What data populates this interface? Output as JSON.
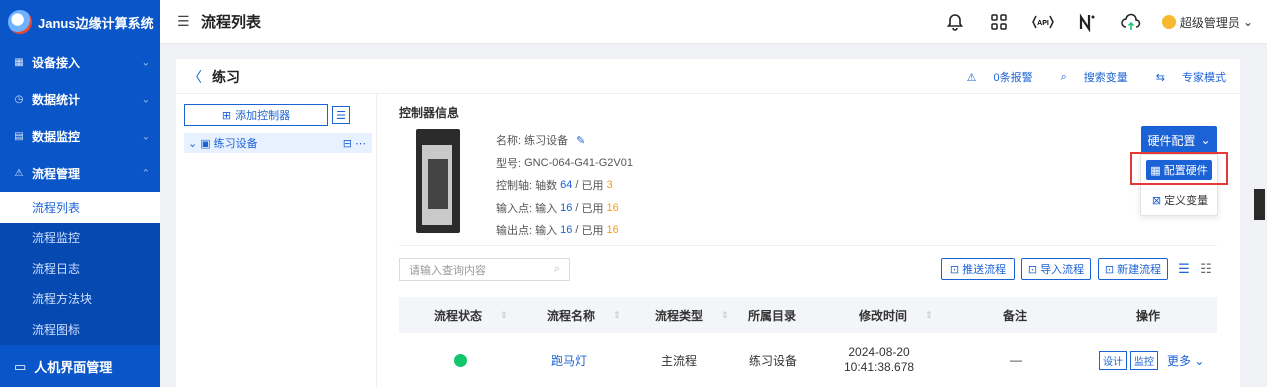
{
  "app": {
    "brand": "Janus边缘计算系统"
  },
  "sidebar": {
    "items": [
      {
        "label": "设备接入",
        "icon": "device-icon"
      },
      {
        "label": "数据统计",
        "icon": "stats-icon"
      },
      {
        "label": "数据监控",
        "icon": "monitor-icon"
      },
      {
        "label": "流程管理",
        "icon": "flow-icon"
      }
    ],
    "sub_items": [
      {
        "label": "流程列表",
        "active": true
      },
      {
        "label": "流程监控"
      },
      {
        "label": "流程日志"
      },
      {
        "label": "流程方法块"
      },
      {
        "label": "流程图标"
      }
    ],
    "bottom": {
      "label": "人机界面管理",
      "icon": "hmi-icon"
    }
  },
  "header": {
    "title": "流程列表",
    "user": "超级管理员",
    "icons": [
      "bell-icon",
      "apps-icon",
      "api-icon",
      "n-logo-icon",
      "cloud-upload-icon"
    ]
  },
  "page": {
    "breadcrumb": "练习",
    "links": {
      "alarm": "0条报警",
      "search_var": "搜索变量",
      "expert": "专家模式"
    }
  },
  "tree": {
    "add_label": "添加控制器",
    "node": "练习设备",
    "node_actions": "⋯"
  },
  "controller": {
    "section_title": "控制器信息",
    "name_label": "名称:",
    "name": "练习设备",
    "model_label": "型号:",
    "model": "GNC-064-G41-G2V01",
    "axis_label": "控制轴:",
    "axis_prefix": "轴数",
    "axis_total": "64",
    "axis_used": "3",
    "input_label": "输入点:",
    "input_prefix": "输入",
    "input_total": "16",
    "input_used": "16",
    "output_label": "输出点:",
    "output_prefix": "输入",
    "output_total": "16",
    "output_used": "16",
    "used_label": "已用",
    "slash": "/"
  },
  "hardware": {
    "button": "硬件配置",
    "menu": [
      "配置硬件",
      "定义变量"
    ]
  },
  "toolbar": {
    "search_placeholder": "请输入查询内容",
    "push": "推送流程",
    "import": "导入流程",
    "new": "新建流程"
  },
  "table": {
    "columns": [
      "流程状态",
      "流程名称",
      "流程类型",
      "所属目录",
      "修改时间",
      "备注",
      "操作"
    ],
    "rows": [
      {
        "status": "running",
        "name": "跑马灯",
        "type": "主流程",
        "dir": "练习设备",
        "time_date": "2024-08-20",
        "time_clock": "10:41:38.678",
        "note": "—",
        "actions": [
          "设计",
          "监控"
        ],
        "more": "更多"
      }
    ]
  },
  "colors": {
    "brand": "#0a56c9",
    "accent": "#1b62d6",
    "status_ok": "#13c56b",
    "warn": "#f29b1c",
    "highlight": "#e53935"
  }
}
